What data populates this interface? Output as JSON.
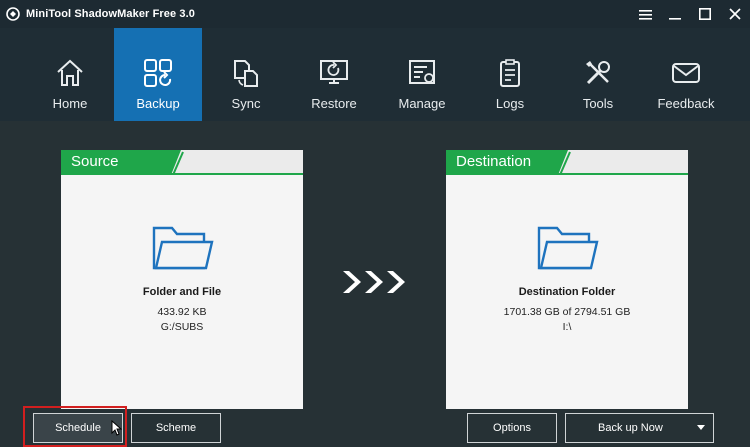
{
  "window": {
    "title": "MiniTool ShadowMaker Free 3.0",
    "controls": [
      "menu-icon",
      "minimize-icon",
      "maximize-icon",
      "close-icon"
    ]
  },
  "nav": {
    "items": [
      {
        "label": "Home",
        "icon": "home-icon"
      },
      {
        "label": "Backup",
        "icon": "backup-icon",
        "active": true
      },
      {
        "label": "Sync",
        "icon": "sync-icon"
      },
      {
        "label": "Restore",
        "icon": "restore-icon"
      },
      {
        "label": "Manage",
        "icon": "manage-icon"
      },
      {
        "label": "Logs",
        "icon": "logs-icon"
      },
      {
        "label": "Tools",
        "icon": "tools-icon"
      },
      {
        "label": "Feedback",
        "icon": "feedback-icon"
      }
    ],
    "active_color": "#1570b3"
  },
  "source": {
    "header": "Source",
    "name": "Folder and File",
    "size": "433.92 KB",
    "path": "G:/SUBS"
  },
  "destination": {
    "header": "Destination",
    "name": "Destination Folder",
    "size": "1701.38 GB of 2794.51 GB",
    "path": "I:\\"
  },
  "buttons": {
    "schedule": "Schedule",
    "scheme": "Scheme",
    "options": "Options",
    "backup_now": "Back up Now"
  },
  "colors": {
    "header_green": "#1fa64a",
    "folder_blue": "#1e73be",
    "highlight_red": "#d21f1f"
  }
}
